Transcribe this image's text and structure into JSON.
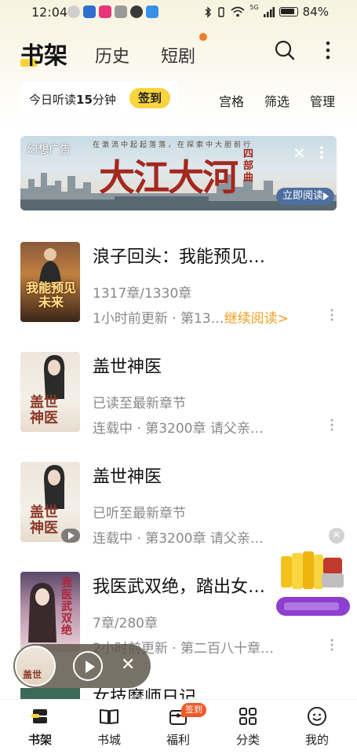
{
  "status_bar": {
    "time": "12:04",
    "network": "5G",
    "battery": "84%"
  },
  "header": {
    "tabs": [
      {
        "label": "书架",
        "active": true
      },
      {
        "label": "历史",
        "active": false
      },
      {
        "label": "短剧",
        "active": false,
        "has_dot": true
      }
    ],
    "icons": [
      "search-icon",
      "more-icon"
    ]
  },
  "listen": {
    "prefix": "今日听读",
    "minutes": "15",
    "suffix": "分钟",
    "signin_label": "签到"
  },
  "toolbar": {
    "grid_label": "宫格",
    "filter_label": "筛选",
    "manage_label": "管理"
  },
  "ad": {
    "label": "幻想广告",
    "slogan": "在激流中起起落落，在探索中大胆前行",
    "title": "大江大河",
    "subtitle": "四部曲",
    "cta": "立即阅读"
  },
  "books": [
    {
      "title": "浪子回头：我能预见…",
      "line2": "1317章/1330章",
      "line3": "1小时前更新 · 第13…",
      "continue_label": "继续阅读>",
      "cover_text": "我能预见未来"
    },
    {
      "title": "盖世神医",
      "line2": "已读至最新章节",
      "line3": "连载中 · 第3200章  请父亲…",
      "cover_text": "盖世神医"
    },
    {
      "title": "盖世神医",
      "line2": "已听至最新章节",
      "line3": "连载中 · 第3200章  请父亲…",
      "cover_text": "盖世神医"
    },
    {
      "title": "我医武双绝，踏出女…",
      "line2": "7章/280章",
      "line3": "2小时前更新 · 第二百八十章…",
      "cover_text": "我医武双绝"
    }
  ],
  "peek_book": {
    "title": "女技摩师日记"
  },
  "mini_player": {
    "cover_text": "盖世"
  },
  "bottom_nav": [
    {
      "label": "书架",
      "icon": "bookshelf-icon",
      "active": true
    },
    {
      "label": "书城",
      "icon": "open-book-icon",
      "active": false
    },
    {
      "label": "福利",
      "icon": "welfare-icon",
      "active": false,
      "badge": "签到"
    },
    {
      "label": "分类",
      "icon": "category-icon",
      "active": false
    },
    {
      "label": "我的",
      "icon": "profile-icon",
      "active": false
    }
  ],
  "colors": {
    "accent_yellow": "#f9d43c",
    "continue_orange": "#f0a020",
    "badge_orange": "#f05a28",
    "ad_title_red": "#a3281e"
  }
}
